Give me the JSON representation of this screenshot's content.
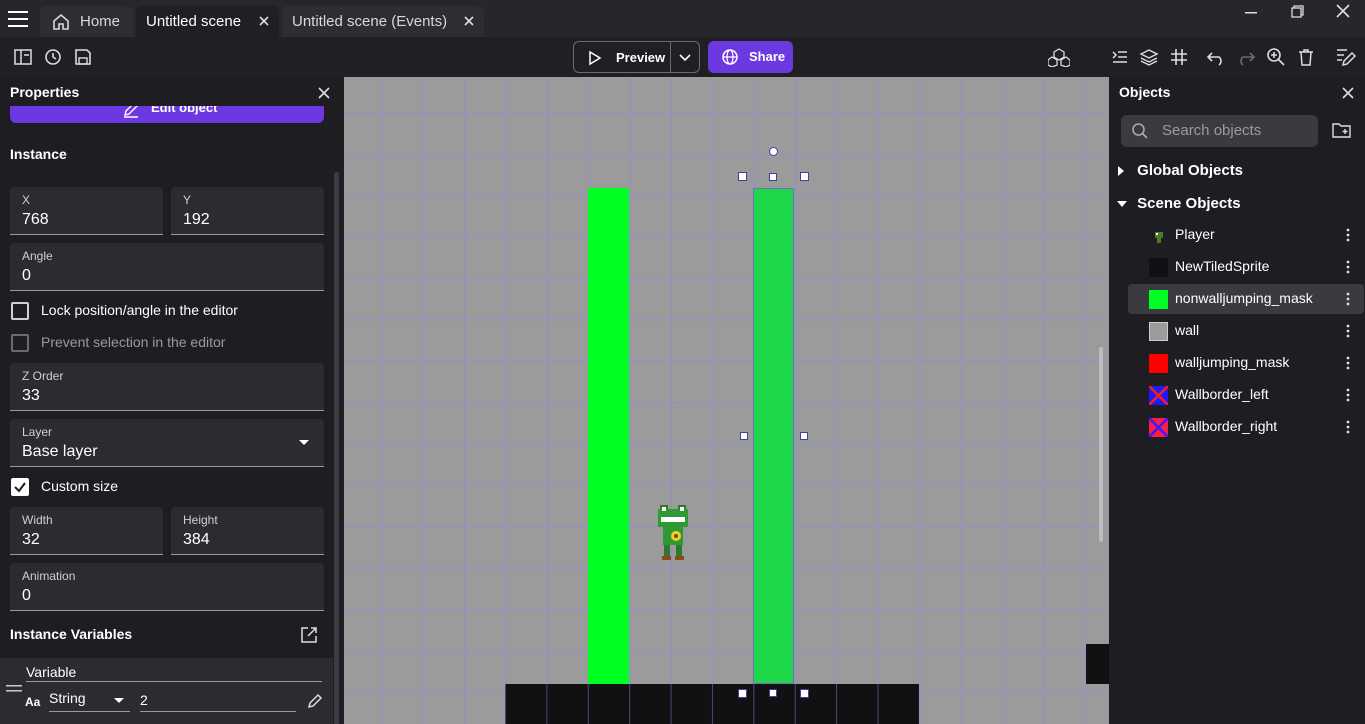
{
  "tabs": [
    {
      "label": "Home"
    },
    {
      "label": "Untitled scene"
    },
    {
      "label": "Untitled scene (Events)"
    }
  ],
  "toolbar": {
    "preview_label": "Preview",
    "share_label": "Share"
  },
  "properties": {
    "title": "Properties",
    "edit_object_label": "Edit object",
    "section_instance": "Instance",
    "x_label": "X",
    "x_value": "768",
    "y_label": "Y",
    "y_value": "192",
    "angle_label": "Angle",
    "angle_value": "0",
    "lock_label": "Lock position/angle in the editor",
    "prevent_label": "Prevent selection in the editor",
    "z_label": "Z Order",
    "z_value": "33",
    "layer_label": "Layer",
    "layer_value": "Base layer",
    "custom_size_label": "Custom size",
    "width_label": "Width",
    "width_value": "32",
    "height_label": "Height",
    "height_value": "384",
    "animation_label": "Animation",
    "animation_value": "0",
    "instance_vars_label": "Instance Variables",
    "variable_header": "Variable",
    "variable_type": "String",
    "variable_value": "2"
  },
  "objects": {
    "title": "Objects",
    "search_placeholder": "Search objects",
    "global_label": "Global Objects",
    "scene_label": "Scene Objects",
    "items": [
      {
        "name": "Player",
        "color": "#4a7a2a"
      },
      {
        "name": "NewTiledSprite",
        "color": "#111114"
      },
      {
        "name": "nonwalljumping_mask",
        "color": "#00ff22"
      },
      {
        "name": "wall",
        "color": "#9b9b9b"
      },
      {
        "name": "walljumping_mask",
        "color": "#ff0000"
      },
      {
        "name": "Wallborder_left",
        "color": "#1a1aff"
      },
      {
        "name": "Wallborder_right",
        "color": "#ff1a4a"
      }
    ]
  },
  "colors": {
    "accent": "#6c38e0",
    "green_mask": "#00ff22",
    "green_selected": "#1ed84a"
  }
}
